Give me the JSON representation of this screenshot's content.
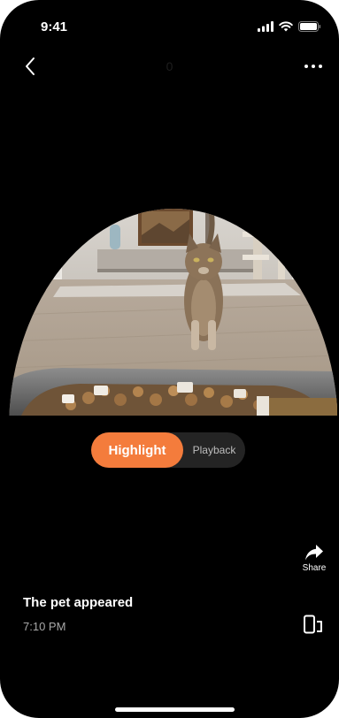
{
  "status_bar": {
    "time": "9:41"
  },
  "header": {
    "title": "0"
  },
  "tabs": {
    "highlight_label": "Highlight",
    "playback_label": "Playback"
  },
  "actions": {
    "share_label": "Share"
  },
  "event": {
    "title": "The pet appeared",
    "time": "7:10 PM"
  },
  "colors": {
    "accent": "#f47c3c",
    "background": "#000000",
    "toggle_bg": "#242424"
  },
  "icons": {
    "back": "chevron-left-icon",
    "more": "more-horizontal-icon",
    "share": "share-arrow-icon",
    "device": "phone-tablet-icon"
  }
}
